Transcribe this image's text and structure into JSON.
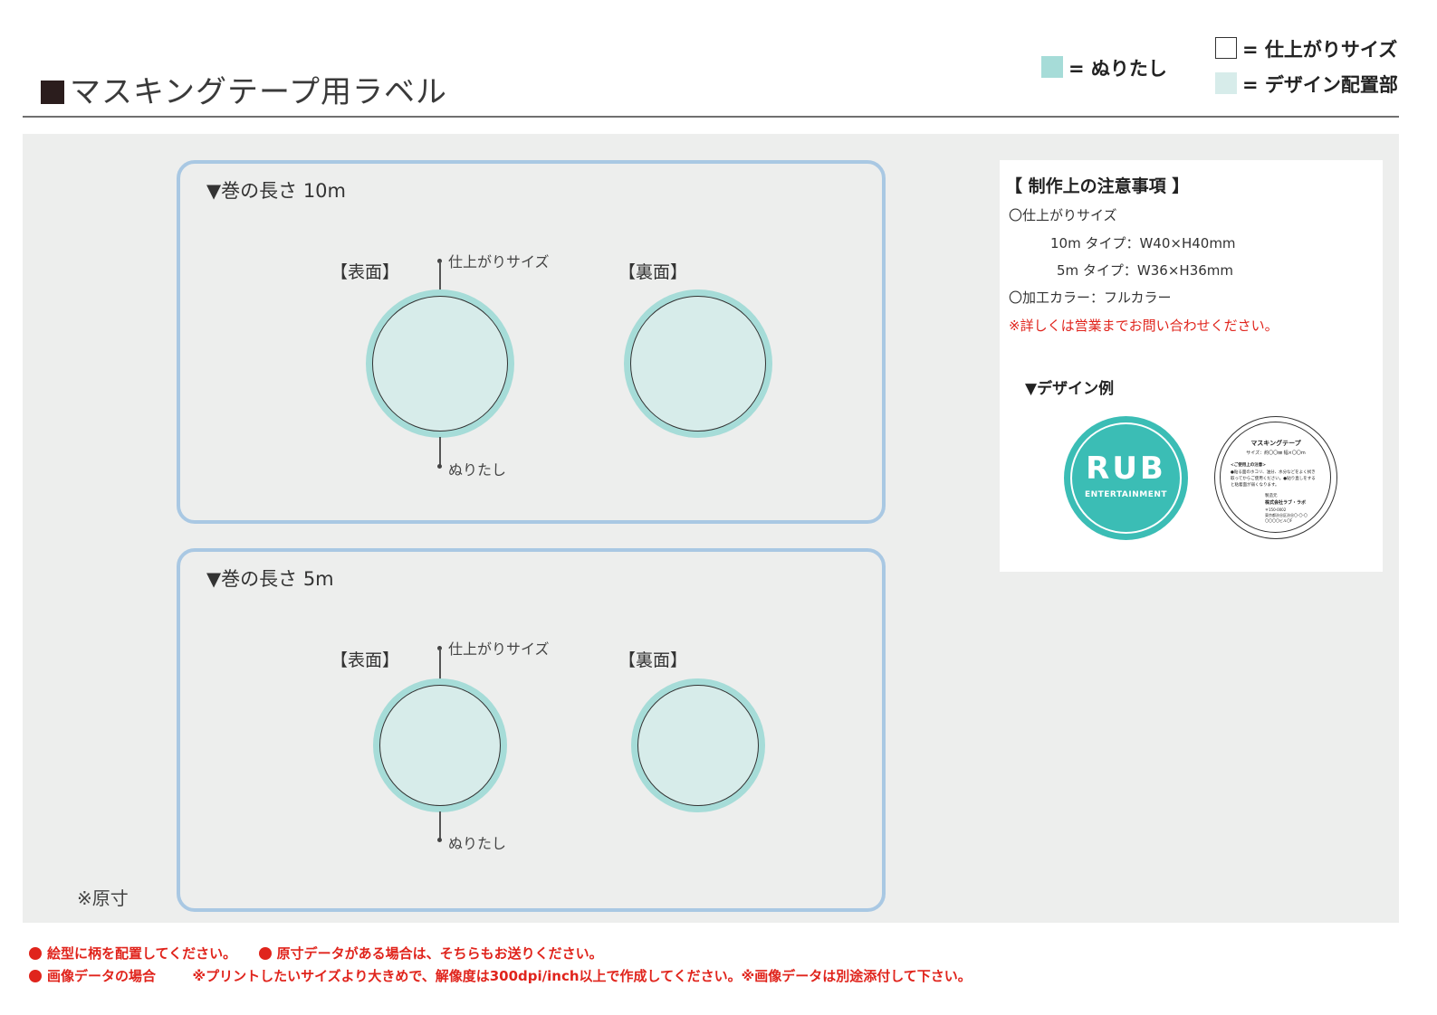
{
  "header": {
    "title": "マスキングテープ用ラベル",
    "legend": {
      "bleed": "= ぬりたし",
      "finish": "= 仕上がりサイズ",
      "design": "= デザイン配置部"
    }
  },
  "colors": {
    "bleed": "#a6dcd8",
    "design": "#d7ecea",
    "box_border": "#a9c8e3",
    "panel": "#edeeed",
    "accent_red": "#e0241c",
    "rub_teal": "#3bbdb5"
  },
  "box10": {
    "heading": "▼巻の長さ 10m",
    "front_label": "【表面】",
    "back_label": "【裏面】",
    "finish_label": "仕上がりサイズ",
    "bleed_label": "ぬりたし"
  },
  "box5": {
    "heading": "▼巻の長さ 5m",
    "front_label": "【表面】",
    "back_label": "【裏面】",
    "finish_label": "仕上がりサイズ",
    "bleed_label": "ぬりたし"
  },
  "original_size_note": "※原寸",
  "notes": {
    "title": "【 制作上の注意事項 】",
    "finish_heading": "〇仕上がりサイズ",
    "size_10m": "10m タイプ：W40×H40mm",
    "size_5m": "5m タイプ：W36×H36mm",
    "color": "〇加工カラー：フルカラー",
    "contact": "※詳しくは営業までお問い合わせください。",
    "example_heading": "▼デザイン例"
  },
  "example_front": {
    "word": "RUB",
    "sub": "ENTERTAINMENT"
  },
  "example_back": {
    "title": "マスキングテープ",
    "size": "サイズ：約〇〇㎜ 幅×〇〇m",
    "caution_title": "<ご使用上の注意>",
    "caution_1": "●貼る面のホコリ、油分、水分などをよく拭き",
    "caution_2": "取ってからご使用ください。●貼り直しをする",
    "caution_3": "と粘着面が弱くなります。",
    "maker_label": "製造元",
    "maker": "株式会社ラブ・ラボ",
    "address_1": "〒150-0002",
    "address_2": "東京都渋谷区渋谷〇-〇-〇",
    "address_3": "〇〇〇〇ビル〇F"
  },
  "bottom_notes": {
    "line1_a": "絵型に柄を配置してください。",
    "line1_b": "原寸データがある場合は、そちらもお送りください。",
    "line2_a": "画像データの場合",
    "line2_b": "※プリントしたいサイズより大きめで、解像度は300dpi/inch以上で作成してください。※画像データは別途添付して下さい。"
  }
}
